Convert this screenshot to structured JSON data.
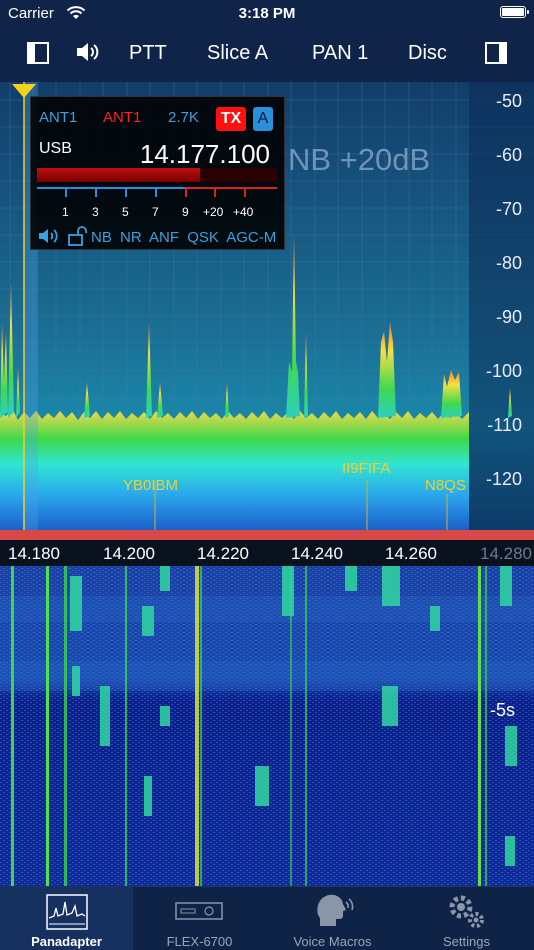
{
  "status_bar": {
    "carrier": "Carrier",
    "time": "3:18 PM"
  },
  "toolbar": {
    "ptt": "PTT",
    "slice": "Slice A",
    "pan": "PAN 1",
    "disc": "Disc"
  },
  "slice": {
    "ant_rx": "ANT1",
    "ant_tx": "ANT1",
    "bandwidth": "2.7K",
    "tx": "TX",
    "letter": "A",
    "mode": "USB",
    "frequency": "14.177.100",
    "s_meter_labels": [
      "1",
      "3",
      "5",
      "7",
      "9",
      "+20",
      "+40"
    ],
    "s_meter_level": 0.68,
    "options": [
      "NB",
      "NR",
      "ANF",
      "QSK",
      "AGC-M"
    ]
  },
  "nb_overlay": "NB +20dB",
  "db_labels": [
    "-50",
    "-60",
    "-70",
    "-80",
    "-90",
    "-100",
    "-110",
    "-120"
  ],
  "spots": [
    "YB0IBM",
    "II9FIFA",
    "N8QS"
  ],
  "freq_labels": [
    "14.180",
    "14.200",
    "14.220",
    "14.240",
    "14.260",
    "14.280"
  ],
  "waterfall_time_label": "-5s",
  "tabs": [
    "Panadapter",
    "FLEX-6700",
    "Voice Macros",
    "Settings"
  ],
  "colors": {
    "background": "#0a1a3a",
    "tx_red": "#ff1010",
    "accent_blue": "#2a8ed8",
    "spot_yellow": "#f0d030"
  }
}
